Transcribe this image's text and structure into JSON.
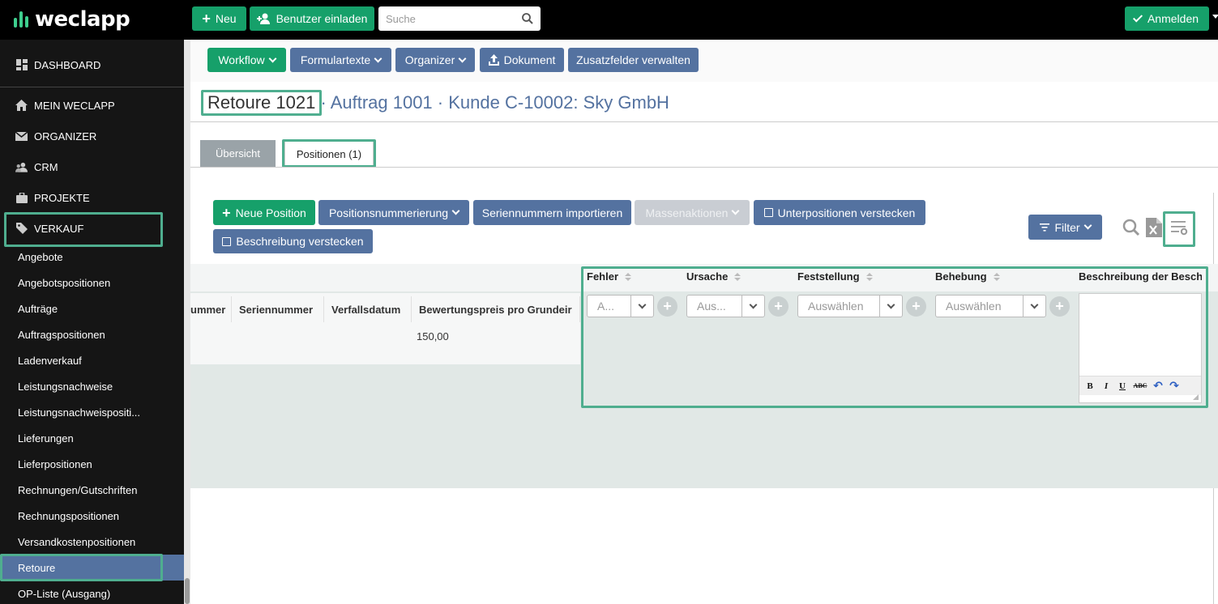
{
  "brand": {
    "name": "weclapp"
  },
  "topbar": {
    "new_label": "Neu",
    "invite_label": "Benutzer einladen",
    "search_placeholder": "Suche",
    "login_label": "Anmelden"
  },
  "sidebar": {
    "top_items": [
      {
        "label": "DASHBOARD",
        "icon": "dashboard-icon"
      },
      {
        "label": "MEIN WECLAPP",
        "icon": "home-icon"
      },
      {
        "label": "ORGANIZER",
        "icon": "envelope-icon"
      },
      {
        "label": "CRM",
        "icon": "users-icon"
      },
      {
        "label": "PROJEKTE",
        "icon": "briefcase-icon"
      },
      {
        "label": "VERKAUF",
        "icon": "tag-icon"
      }
    ],
    "sub_items": [
      "Angebote",
      "Angebotspositionen",
      "Aufträge",
      "Auftragspositionen",
      "Ladenverkauf",
      "Leistungsnachweise",
      "Leistungsnachweispositi...",
      "Lieferungen",
      "Lieferpositionen",
      "Rechnungen/Gutschriften",
      "Rechnungspositionen",
      "Versandkostenpositionen",
      "Retoure",
      "OP-Liste (Ausgang)"
    ]
  },
  "toolbar": {
    "workflow": "Workflow",
    "formulartexte": "Formulartexte",
    "organizer": "Organizer",
    "dokument": "Dokument",
    "zusatzfelder": "Zusatzfelder verwalten"
  },
  "title": {
    "record": "Retoure 1021",
    "sep": "·",
    "order": "Auftrag 1001",
    "customer": "Kunde C-10002: Sky GmbH"
  },
  "tabs": [
    "Übersicht",
    "Positionen (1)"
  ],
  "actions": {
    "neue_position": "Neue Position",
    "positionsnummerierung": "Positionsnummerierung",
    "seriennummern_importieren": "Seriennummern importieren",
    "massenaktionen": "Massenaktionen",
    "unterpositionen_verstecken": "Unterpositionen verstecken",
    "beschreibung_verstecken": "Beschreibung verstecken",
    "filter": "Filter"
  },
  "grid": {
    "columns": [
      "ummer",
      "Seriennummer",
      "Verfallsdatum",
      "Bewertungspreis pro Grundeir"
    ],
    "row": {
      "bewertungspreis": "150,00"
    },
    "fields": [
      {
        "header": "Fehler",
        "placeholder": "A..."
      },
      {
        "header": "Ursache",
        "placeholder": "Aus..."
      },
      {
        "header": "Feststellung",
        "placeholder": "Auswählen"
      },
      {
        "header": "Behebung",
        "placeholder": "Auswählen"
      },
      {
        "header": "Beschreibung der Besch"
      }
    ],
    "editor_buttons": [
      "B",
      "I",
      "U",
      "ABC"
    ]
  },
  "colors": {
    "accent": "#16a06a",
    "blue": "#5472a0",
    "highlight": "#4fae8f",
    "sidebar": "#151515"
  }
}
